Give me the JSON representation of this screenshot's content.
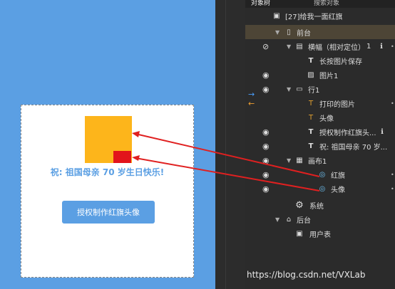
{
  "preview": {
    "greeting": "祝: 祖国母亲 70 岁生日快乐!",
    "button_label": "授权制作红旗头像"
  },
  "panel": {
    "tab_active": "对象树",
    "tab_other": "搜索对象",
    "rows": [
      {
        "label": "[27]给我一面红旗",
        "icon": "scene-icon"
      },
      {
        "label": "前台",
        "icon": "phone-icon"
      },
      {
        "label": "横幅（相对定位）",
        "suffix": "1",
        "icon": "layout-icon"
      },
      {
        "label": "长按图片保存",
        "icon": "text-icon"
      },
      {
        "label": "图片1",
        "icon": "image-icon"
      },
      {
        "label": "行1",
        "icon": "row-icon"
      },
      {
        "label": "打印的图片",
        "icon": "text-icon"
      },
      {
        "label": "头像",
        "icon": "text-icon"
      },
      {
        "label": "授权制作红旗头...",
        "icon": "text-icon"
      },
      {
        "label": "祝: 祖国母亲 70 岁...",
        "icon": "text-icon"
      },
      {
        "label": "画布1",
        "icon": "canvas-icon"
      },
      {
        "label": "红旗",
        "icon": "canvas-item-icon"
      },
      {
        "label": "头像",
        "icon": "canvas-item-icon"
      },
      {
        "label": "系统",
        "icon": "gear-icon"
      },
      {
        "label": "后台",
        "icon": "backend-icon"
      },
      {
        "label": "用户表",
        "icon": "user-table-icon"
      }
    ]
  },
  "watermark": "https://blog.csdn.net/VXLab",
  "colors": {
    "flag": "#fdb51b",
    "avatar": "#e2141b",
    "accent": "#5b9fe3",
    "arrow": "#e02020"
  }
}
